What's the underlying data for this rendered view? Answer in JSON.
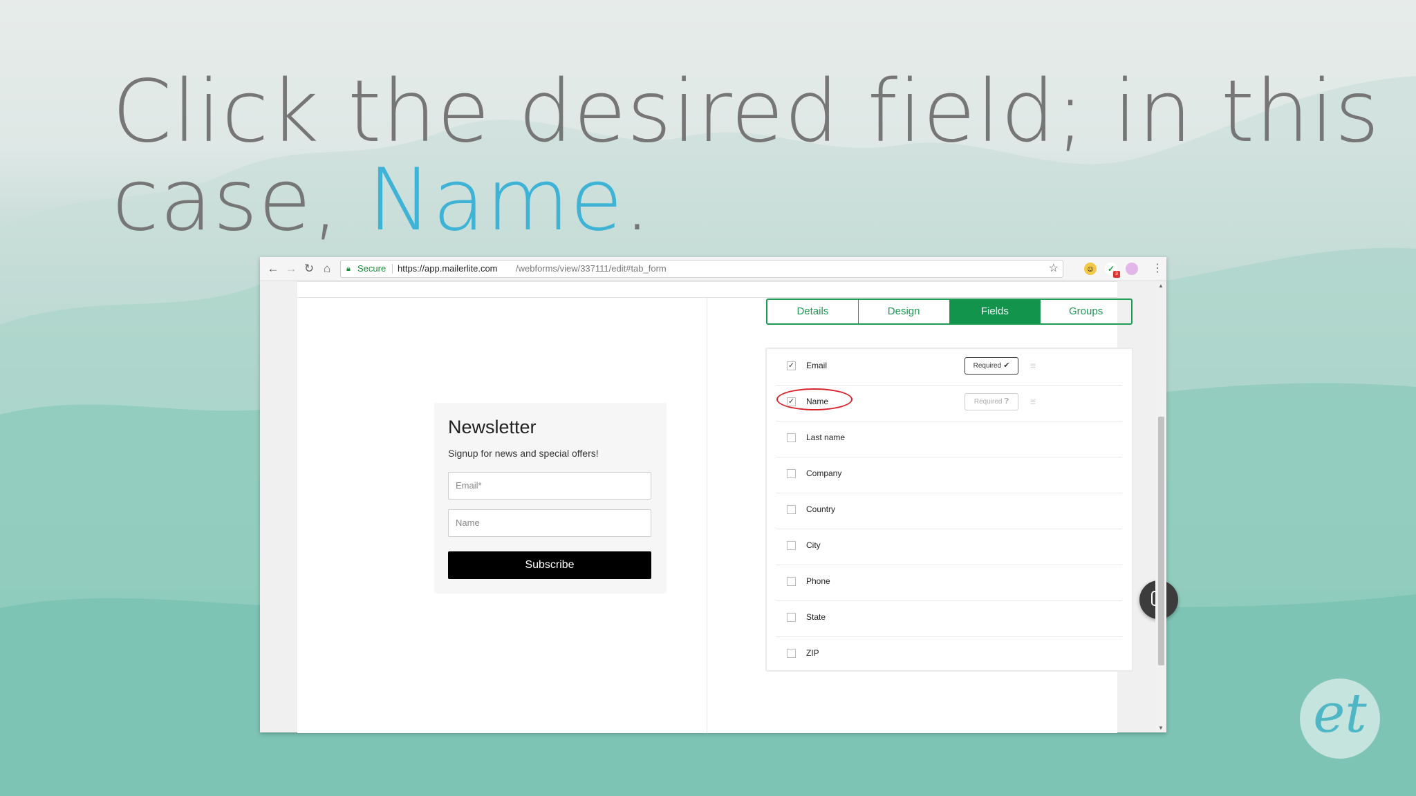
{
  "slide": {
    "title_part1": "Click the desired field; in this case, ",
    "title_highlight": "Name",
    "title_end": "."
  },
  "colors": {
    "accent": "#3fb3d6",
    "brand_green": "#12944c",
    "highlight_circle": "#d8232a"
  },
  "browser": {
    "secure_label": "Secure",
    "url_host": "https://app.mailerlite.com",
    "url_path": "/webforms/view/337111/edit#tab_form",
    "icons": [
      "back-icon",
      "forward-icon",
      "reload-icon",
      "home-icon",
      "lock-icon",
      "star-icon",
      "menu-icon"
    ],
    "extension_badge": "3"
  },
  "preview": {
    "title": "Newsletter",
    "subtitle": "Signup for news and special offers!",
    "email_placeholder": "Email*",
    "name_placeholder": "Name",
    "subscribe_label": "Subscribe"
  },
  "tabs": [
    {
      "label": "Details",
      "active": false
    },
    {
      "label": "Design",
      "active": false
    },
    {
      "label": "Fields",
      "active": true
    },
    {
      "label": "Groups",
      "active": false
    }
  ],
  "fields": [
    {
      "label": "Email",
      "checked": true,
      "required_label": "Required",
      "required_on": true
    },
    {
      "label": "Name",
      "checked": true,
      "required_label": "Required",
      "required_on": false
    },
    {
      "label": "Last name",
      "checked": false
    },
    {
      "label": "Company",
      "checked": false
    },
    {
      "label": "Country",
      "checked": false
    },
    {
      "label": "City",
      "checked": false
    },
    {
      "label": "Phone",
      "checked": false
    },
    {
      "label": "State",
      "checked": false
    },
    {
      "label": "ZIP",
      "checked": false
    }
  ],
  "logo": {
    "text": "et"
  }
}
